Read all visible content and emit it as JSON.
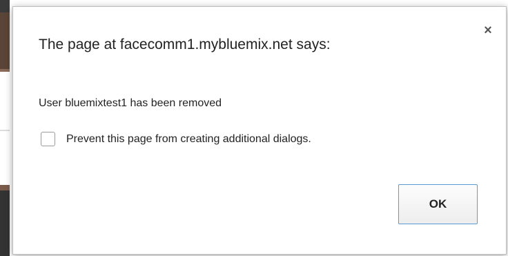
{
  "dialog": {
    "title": "The page at facecomm1.mybluemix.net says:",
    "close_glyph": "×",
    "message": "User bluemixtest1 has been removed",
    "checkbox_label": "Prevent this page from creating additional dialogs.",
    "checkbox_checked": false,
    "ok_label": "OK",
    "ok_border_color": "#5b9bd5"
  }
}
